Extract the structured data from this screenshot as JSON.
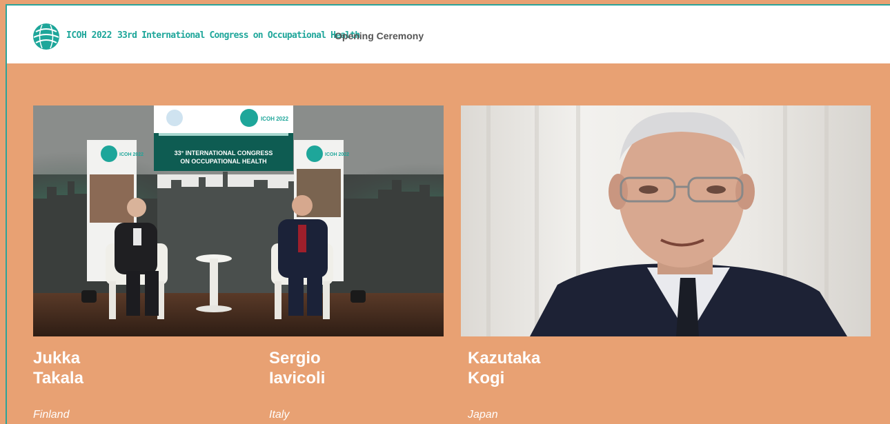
{
  "header": {
    "brand": "ICOH 2022",
    "congress": "33rd International Congress on Occupational Health",
    "section": "Opening Ceremony"
  },
  "stage": {
    "screen_text_line1": "33° INTERNATIONAL CONGRESS",
    "screen_text_line2": "ON OCCUPATIONAL HEALTH",
    "screen_logo": "ICOH 2022",
    "banner_left": "ICOH 2022",
    "banner_right": "ICOH 2022"
  },
  "speakers": [
    {
      "first": "Jukka",
      "last": "Takala",
      "country": "Finland"
    },
    {
      "first": "Sergio",
      "last": "Iavicoli",
      "country": "Italy"
    },
    {
      "first": "Kazutaka",
      "last": "Kogi",
      "country": "Japan"
    }
  ],
  "colors": {
    "background": "#e8a173",
    "accent": "#1ea69a",
    "header_bg": "#ffffff"
  }
}
